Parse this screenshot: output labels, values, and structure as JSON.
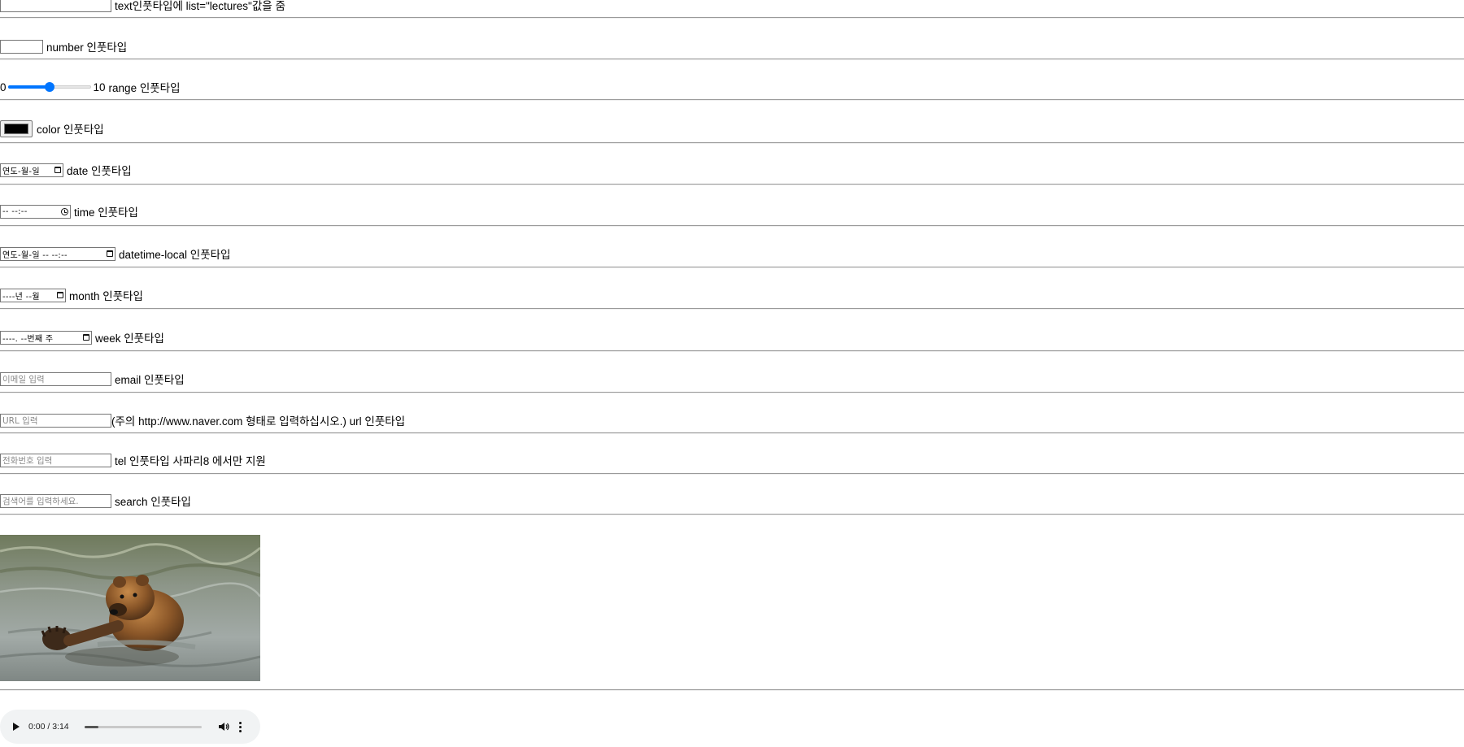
{
  "fields": {
    "text": {
      "value": "",
      "label": "text인풋타입에 list=\"lectures\"값을 줌"
    },
    "number": {
      "value": "",
      "label": "number 인풋타입"
    },
    "range": {
      "min_label": "0",
      "max_label": "10",
      "value_fraction": 0.5,
      "label": "range 인풋타입"
    },
    "color": {
      "value": "#000000",
      "label": "color 인풋타입"
    },
    "date": {
      "display": "연도-월-일",
      "label": "date 인풋타입"
    },
    "time": {
      "display": "-- --:--",
      "label": "time 인풋타입"
    },
    "datetime_local": {
      "display": "연도-월-일 -- --:--",
      "label": "datetime-local 인풋타입"
    },
    "month": {
      "display": "----년 --월",
      "label": "month 인풋타입"
    },
    "week": {
      "display": "----. --번째 주",
      "label": "week 인풋타입"
    },
    "email": {
      "placeholder": "이메일 입력",
      "label": "email 인풋타입"
    },
    "url": {
      "placeholder": "URL 입력",
      "label": "(주의 http://www.naver.com 형태로 입력하십시오.) url 인풋타입"
    },
    "tel": {
      "placeholder": "전화번호 입력",
      "label": "tel 인풋타입 사파리8 에서만 지원"
    },
    "search": {
      "placeholder": "검색어를 입력하세요.",
      "label": "search 인풋타입"
    }
  },
  "image": {
    "subject": "brown bear swimming in water"
  },
  "audio": {
    "time": "0:00 / 3:14",
    "buffered_fraction": 0.12
  },
  "colors": {
    "accent": "#0075ff",
    "divider": "#9a9a9a"
  }
}
